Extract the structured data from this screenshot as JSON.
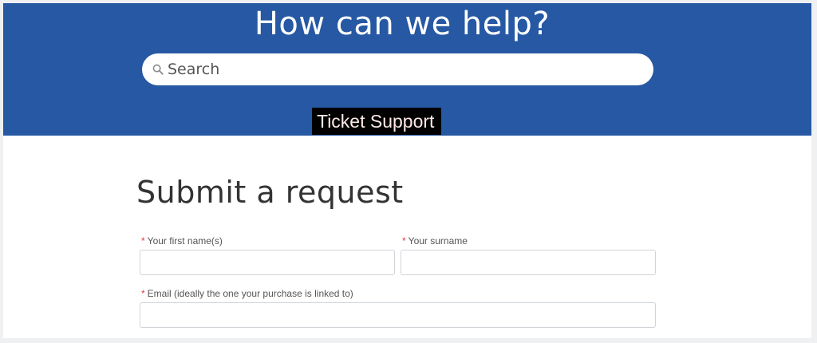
{
  "hero": {
    "title": "How can we help?",
    "search_placeholder": "Search",
    "search_icon": "magnifier-icon",
    "background_color": "#2658a3"
  },
  "ticket_badge": {
    "label": "Ticket Support"
  },
  "form": {
    "title": "Submit a request",
    "required_marker": "*",
    "fields": {
      "first_name": {
        "label": "Your first name(s)",
        "value": ""
      },
      "surname": {
        "label": "Your surname",
        "value": ""
      },
      "email": {
        "label": "Email (ideally the one your purchase is linked to)",
        "value": ""
      }
    }
  }
}
